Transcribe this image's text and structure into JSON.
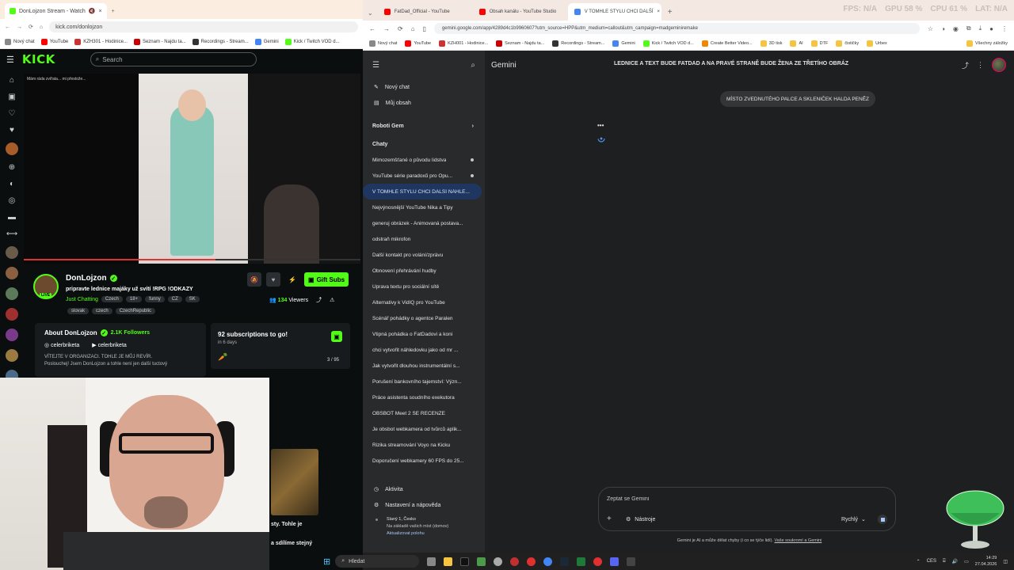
{
  "left_browser": {
    "tabs": [
      {
        "label": "DonLojzon Stream - Watch",
        "color": "#53fc18"
      }
    ],
    "url": "kick.com/donlojzon",
    "bookmarks": [
      "Nový chat",
      "YouTube",
      "KZH301 - Hodinice...",
      "Seznam - Najdu ta...",
      "Recordings - Stream...",
      "Gemini",
      "Kick / Twitch VOD d..."
    ]
  },
  "kick": {
    "logo": "KICK",
    "search_placeholder": "Search",
    "video_caption": "Mám ráda zvířata... mi přestože...",
    "streamer_name": "DonLojzon",
    "live_badge": "LIVE",
    "stream_title": "pripravte lednice majáky už svítí !RPG !ODKAZY",
    "category": "Just Chatting",
    "tags_row1": [
      "Czech",
      "18+",
      "funny",
      "CZ",
      "SK"
    ],
    "tags_row2": [
      "slovak",
      "czech",
      "CzechRepublic"
    ],
    "gift_label": "Gift Subs",
    "viewers": "134",
    "viewers_label": "Viewers",
    "about_title": "About DonLojzon",
    "followers": "2.1K",
    "followers_label": "Followers",
    "socials": [
      "celerbriketa",
      "celerbriketa"
    ],
    "about_desc_1": "VÍTEJTE V ORGANIZACI. TOHLE JE MŮJ REVÍR.",
    "about_desc_2": "Poslouchej! Jsem DonLojzon a tohle není jen další tuctový",
    "subs_title": "92 subscriptions to go!",
    "subs_days": "in 6 days",
    "subs_count": "3 / 95",
    "chat_snip_1": "sty. Tohle je",
    "chat_snip_2": "a sdílíme stejný",
    "progress": 0.57
  },
  "right_browser": {
    "tabs": [
      {
        "label": "FatDad_Official - YouTube",
        "color": "#ff0000",
        "active": false
      },
      {
        "label": "Obsah kanálu - YouTube Studio",
        "color": "#ff0000",
        "active": false
      },
      {
        "label": "V TOMHLE STYLU CHCI DALŠÍ",
        "color": "#4285f4",
        "active": true
      }
    ],
    "stats": {
      "fps": "FPS: N/A",
      "gpu": "GPU 58 %",
      "cpu": "CPU 61 %",
      "lat": "LAT: N/A"
    },
    "url": "gemini.google.com/app/4289d4c1b9960607?utm_source=HPP&utm_medium=callout&utm_campaign=madgeminiremake",
    "bookmarks": [
      "Nový chat",
      "YouTube",
      "KZH001 - Hodinice...",
      "Seznam - Najdu ta...",
      "Recordings - Stream...",
      "Gemini",
      "Kick / Twitch VOD d...",
      "Create Better Video...",
      "3D tisk",
      "AI",
      "DTF",
      "čističky",
      "Urbex",
      "Všechny záložky"
    ]
  },
  "gemini": {
    "brand": "Gemini",
    "nav": [
      "Nový chat",
      "Můj obsah"
    ],
    "gems_label": "Roboti Gem",
    "chats_label": "Chaty",
    "chats": [
      {
        "title": "Mimozemšťané o původu lidstva",
        "dot": true,
        "active": false
      },
      {
        "title": "YouTube série paradoxů pro Opu...",
        "dot": true,
        "active": false
      },
      {
        "title": "V TOMHLE STYLU CHCI DALŠÍ NÁHLE...",
        "dot": false,
        "active": true
      },
      {
        "title": "Nejvýnosnější YouTube Nika a Tipy",
        "dot": false,
        "active": false
      },
      {
        "title": "generuj obrázek - Animovaná postava...",
        "dot": false,
        "active": false
      },
      {
        "title": "odstraň mikrofon",
        "dot": false,
        "active": false
      },
      {
        "title": "Další kontakt pro volání/zprávu",
        "dot": false,
        "active": false
      },
      {
        "title": "Obnovení přehrávání hudby",
        "dot": false,
        "active": false
      },
      {
        "title": "Úprava textu pro sociální sítě",
        "dot": false,
        "active": false
      },
      {
        "title": "Alternativy k VidIQ pro YouTube",
        "dot": false,
        "active": false
      },
      {
        "title": "Scénář pohádky o agentce Paralen",
        "dot": false,
        "active": false
      },
      {
        "title": "Vtipná pohádka o FatDadovi a koni",
        "dot": false,
        "active": false
      },
      {
        "title": "chci vytvořit náhledovku jako od mr ...",
        "dot": false,
        "active": false
      },
      {
        "title": "Jak vytvořit dlouhou instrumentální s...",
        "dot": false,
        "active": false
      },
      {
        "title": "Porušení bankovního tajemství: Význ...",
        "dot": false,
        "active": false
      },
      {
        "title": "Práce asistenta soudního exekutora",
        "dot": false,
        "active": false
      },
      {
        "title": "OBSBOT Meet 2 SE RECENZE",
        "dot": false,
        "active": false
      },
      {
        "title": "Je obsbot webkamera od tvůrců aplik...",
        "dot": false,
        "active": false
      },
      {
        "title": "Rizika streamování Voyo na Kicku",
        "dot": false,
        "active": false
      },
      {
        "title": "Doporučení webkamery 60 FPS do 25...",
        "dot": false,
        "active": false
      }
    ],
    "activity": "Aktivita",
    "settings": "Nastavení a nápověda",
    "location_city": "Slaný 1, Česko",
    "location_basis": "Na základě vašich míst (domov)",
    "location_update": "Aktualizovat polohu",
    "chat_title": "LEDNICE A TEXT BUDE FATDAD A NA PRAVÉ STRANĚ BUDE ŽENA ZE TŘETÍHO OBRÁZ",
    "user_message": "MÍSTO ZVEDNUTÉHO PALCE A SKLENIČEK HALDA PENĚZ",
    "loading_dots": "•••",
    "prompt_placeholder": "Zeptat se Gemini",
    "tools_label": "Nástroje",
    "mode_label": "Rychlý",
    "disclaimer": "Gemini je AI a může dělat chyby (i co se týče lidí).",
    "privacy_link": "Vaše soukromí a Gemini"
  },
  "taskbar": {
    "search_placeholder": "Hledat",
    "lang": "CES",
    "time": "14:29",
    "date": "27.04.2026"
  },
  "colors": {
    "kick_green": "#53fc18",
    "gemini_bg": "#1e1f20",
    "gemini_sidebar": "#282a2c",
    "active_chat": "#1f3760"
  }
}
